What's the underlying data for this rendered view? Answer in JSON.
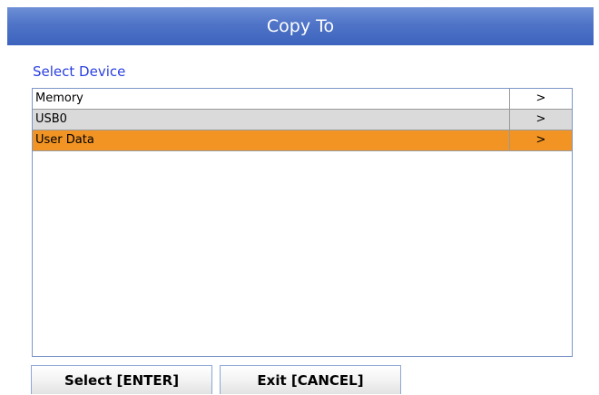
{
  "dialog": {
    "title": "Copy To"
  },
  "device_section": {
    "label": "Select Device"
  },
  "devices": [
    {
      "name": "Memory",
      "chevron": ">",
      "state": "normal"
    },
    {
      "name": "USB0",
      "chevron": ">",
      "state": "alternate"
    },
    {
      "name": "User Data",
      "chevron": ">",
      "state": "selected"
    }
  ],
  "buttons": {
    "select_label": "Select [ENTER]",
    "exit_label": "Exit [CANCEL]"
  },
  "colors": {
    "title_bar": "#4f74c7",
    "label_text": "#2b3fe0",
    "selected_row": "#f29424",
    "alternate_row": "#dadada"
  }
}
